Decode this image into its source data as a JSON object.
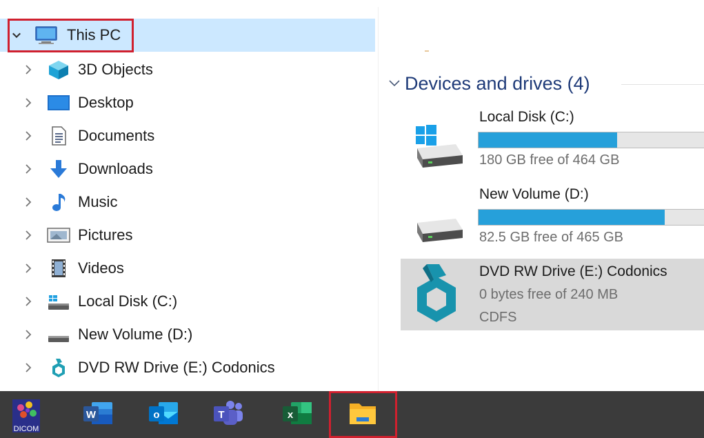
{
  "nav": {
    "items": [
      {
        "label": "This PC",
        "icon": "computer-icon",
        "expanded": true,
        "selected": true
      },
      {
        "label": "3D Objects",
        "icon": "3d-objects-icon"
      },
      {
        "label": "Desktop",
        "icon": "desktop-icon"
      },
      {
        "label": "Documents",
        "icon": "documents-icon"
      },
      {
        "label": "Downloads",
        "icon": "downloads-icon"
      },
      {
        "label": "Music",
        "icon": "music-icon"
      },
      {
        "label": "Pictures",
        "icon": "pictures-icon"
      },
      {
        "label": "Videos",
        "icon": "videos-icon"
      },
      {
        "label": "Local Disk (C:)",
        "icon": "windows-drive-icon"
      },
      {
        "label": "New Volume (D:)",
        "icon": "drive-icon"
      },
      {
        "label": "DVD RW Drive (E:) Codonics",
        "icon": "codonics-icon"
      }
    ]
  },
  "content": {
    "group_title": "Devices and drives (4)",
    "drives": [
      {
        "name": "Local Disk (C:)",
        "free_text": "180 GB free of 464 GB",
        "used_fraction": 0.612,
        "icon": "windows-drive-icon"
      },
      {
        "name": "New Volume (D:)",
        "free_text": "82.5 GB free of 465 GB",
        "used_fraction": 0.823,
        "icon": "drive-icon"
      },
      {
        "name": "DVD RW Drive (E:) Codonics",
        "free_text": "0 bytes free of 240 MB",
        "filesystem": "CDFS",
        "icon": "codonics-icon",
        "highlighted": true
      }
    ]
  },
  "taskbar": {
    "apps": [
      {
        "name": "DICOM",
        "label": "DICOM",
        "icon": "dicom-app-icon"
      },
      {
        "name": "Word",
        "letter": "W",
        "icon": "word-icon",
        "color": "#2b579a"
      },
      {
        "name": "Outlook",
        "letter": "o",
        "icon": "outlook-icon",
        "color": "#0072c6"
      },
      {
        "name": "Teams",
        "letter": "T",
        "icon": "teams-icon",
        "color": "#5b5fc7"
      },
      {
        "name": "Excel",
        "letter": "x",
        "icon": "excel-icon",
        "color": "#217346"
      },
      {
        "name": "File Explorer",
        "icon": "file-explorer-icon",
        "active": true
      }
    ]
  },
  "colors": {
    "selection": "#cce8ff",
    "highlight_box": "#d0202e",
    "bar_fill": "#26a0da",
    "group_title": "#1e3a78",
    "taskbar": "#3b3b3b"
  }
}
